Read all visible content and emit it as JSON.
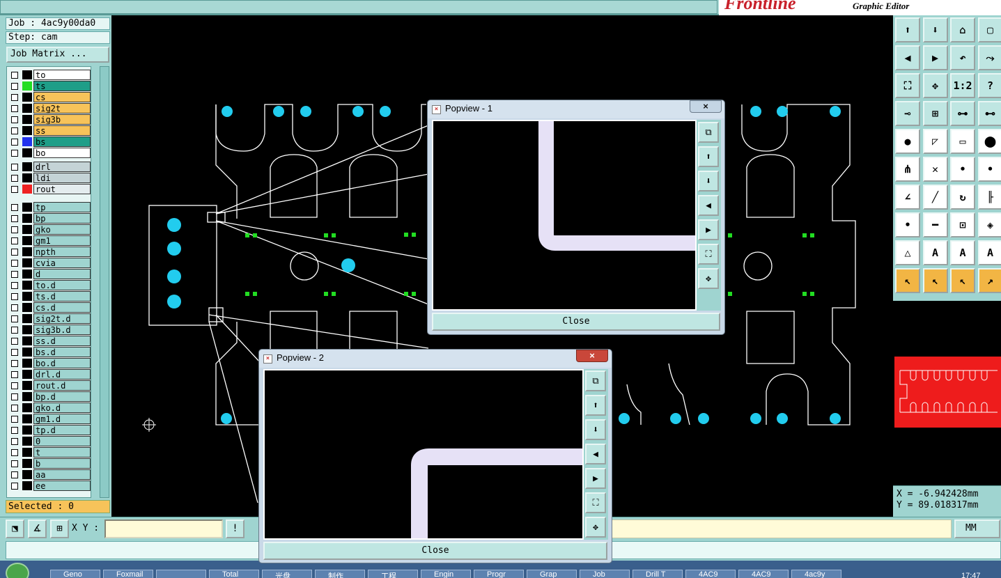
{
  "header": {
    "brand": "Frontline",
    "subtitle": "Graphic Editor"
  },
  "job_info": {
    "job_line": "Job : 4ac9y00da0",
    "step_line": "Step: cam",
    "job_matrix_label": "Job Matrix ..."
  },
  "layers": [
    {
      "name": "to",
      "color": "#ffffff",
      "swatch": "#000000"
    },
    {
      "name": "ts",
      "color": "#1f9e88",
      "swatch": "#22dd22"
    },
    {
      "name": "cs",
      "color": "#f7c35a",
      "swatch": "#000000"
    },
    {
      "name": "sig2t",
      "color": "#f7c35a",
      "swatch": "#000000"
    },
    {
      "name": "sig3b",
      "color": "#f7c35a",
      "swatch": "#000000"
    },
    {
      "name": "ss",
      "color": "#f7c35a",
      "swatch": "#000000"
    },
    {
      "name": "bs",
      "color": "#1f9e88",
      "swatch": "#2233ee"
    },
    {
      "name": "bo",
      "color": "#ffffff",
      "swatch": "#000000"
    },
    {
      "name": "drl",
      "color": "#c4d3d6",
      "swatch": "#000000"
    },
    {
      "name": "ldi",
      "color": "#c4d3d6",
      "swatch": "#000000"
    },
    {
      "name": "rout",
      "color": "#e4ecee",
      "swatch": "#ee2222"
    },
    {
      "name": "tp",
      "color": "#9fd4d0",
      "swatch": "#000000"
    },
    {
      "name": "bp",
      "color": "#9fd4d0",
      "swatch": "#000000"
    },
    {
      "name": "gko",
      "color": "#9fd4d0",
      "swatch": "#000000"
    },
    {
      "name": "gm1",
      "color": "#9fd4d0",
      "swatch": "#000000"
    },
    {
      "name": "npth",
      "color": "#9fd4d0",
      "swatch": "#000000"
    },
    {
      "name": "cvia",
      "color": "#9fd4d0",
      "swatch": "#000000"
    },
    {
      "name": "d",
      "color": "#9fd4d0",
      "swatch": "#000000"
    },
    {
      "name": "to.d",
      "color": "#9fd4d0",
      "swatch": "#000000"
    },
    {
      "name": "ts.d",
      "color": "#9fd4d0",
      "swatch": "#000000"
    },
    {
      "name": "cs.d",
      "color": "#9fd4d0",
      "swatch": "#000000"
    },
    {
      "name": "sig2t.d",
      "color": "#9fd4d0",
      "swatch": "#000000"
    },
    {
      "name": "sig3b.d",
      "color": "#9fd4d0",
      "swatch": "#000000"
    },
    {
      "name": "ss.d",
      "color": "#9fd4d0",
      "swatch": "#000000"
    },
    {
      "name": "bs.d",
      "color": "#9fd4d0",
      "swatch": "#000000"
    },
    {
      "name": "bo.d",
      "color": "#9fd4d0",
      "swatch": "#000000"
    },
    {
      "name": "drl.d",
      "color": "#9fd4d0",
      "swatch": "#000000"
    },
    {
      "name": "rout.d",
      "color": "#9fd4d0",
      "swatch": "#000000"
    },
    {
      "name": "bp.d",
      "color": "#9fd4d0",
      "swatch": "#000000"
    },
    {
      "name": "gko.d",
      "color": "#9fd4d0",
      "swatch": "#000000"
    },
    {
      "name": "gm1.d",
      "color": "#9fd4d0",
      "swatch": "#000000"
    },
    {
      "name": "tp.d",
      "color": "#9fd4d0",
      "swatch": "#000000"
    },
    {
      "name": "0",
      "color": "#9fd4d0",
      "swatch": "#000000"
    },
    {
      "name": "t",
      "color": "#9fd4d0",
      "swatch": "#000000"
    },
    {
      "name": "b",
      "color": "#9fd4d0",
      "swatch": "#000000"
    },
    {
      "name": "aa",
      "color": "#9fd4d0",
      "swatch": "#000000"
    },
    {
      "name": "ee",
      "color": "#9fd4d0",
      "swatch": "#000000"
    }
  ],
  "selected_text": "Selected : 0",
  "coords": {
    "x_text": "X = -6.942428mm",
    "y_text": "Y = 89.018317mm"
  },
  "bottom": {
    "xy_label": "X Y :",
    "xy_value": "",
    "exclaim": "!",
    "unit": "MM"
  },
  "popup1": {
    "title": "Popview - 1",
    "close_x": "×",
    "close_label": "Close"
  },
  "popup2": {
    "title": "Popview - 2",
    "close_x": "×",
    "close_label": "Close"
  },
  "right_tools_icons": [
    "layer-up-icon",
    "layer-down-icon",
    "home-icon",
    "zoom-window-icon",
    "pan-left-icon",
    "pan-right-icon",
    "undo-icon",
    "step-icon",
    "fit-icon",
    "center-icon",
    "ratio-icon",
    "help-icon",
    "measure-icon",
    "grid-icon",
    "snap-icon",
    "snap2-icon",
    "pad-icon",
    "edit-line-icon",
    "ruler-icon",
    "circle-icon",
    "connect-icon",
    "cross-icon",
    "point-icon",
    "point2-icon",
    "angle-icon",
    "line-icon",
    "arc-icon",
    "pin-icon",
    "node-icon",
    "minus-icon",
    "box-icon",
    "shapes-icon",
    "triangle-icon",
    "a-icon",
    "a2-icon",
    "a3-icon",
    "pointer-icon",
    "pointer2-icon",
    "pointer3-icon",
    "pointer4-icon"
  ],
  "right_tools_glyphs": [
    "⬆",
    "⬇",
    "⌂",
    "▢",
    "◀",
    "▶",
    "↶",
    "⤳",
    "⛶",
    "✥",
    "1:2",
    "?",
    "⊸",
    "⊞",
    "⊶",
    "⊷",
    "●",
    "◸",
    "▭",
    "⬤",
    "⋔",
    "✕",
    "•",
    "•",
    "∠",
    "╱",
    "↻",
    "╟",
    "•",
    "━",
    "⊡",
    "◈",
    "△",
    "A",
    "A",
    "A",
    "↖",
    "↖",
    "↖",
    "↗"
  ],
  "taskbar_items": [
    "Geno",
    "Foxmail",
    "",
    "Total",
    "光盘",
    "制作",
    "工程",
    "Engin",
    "Progr",
    "Grap",
    "Job",
    "Drill T",
    "4AC9",
    "4AC9",
    "4ac9y"
  ],
  "clock": "17:47"
}
